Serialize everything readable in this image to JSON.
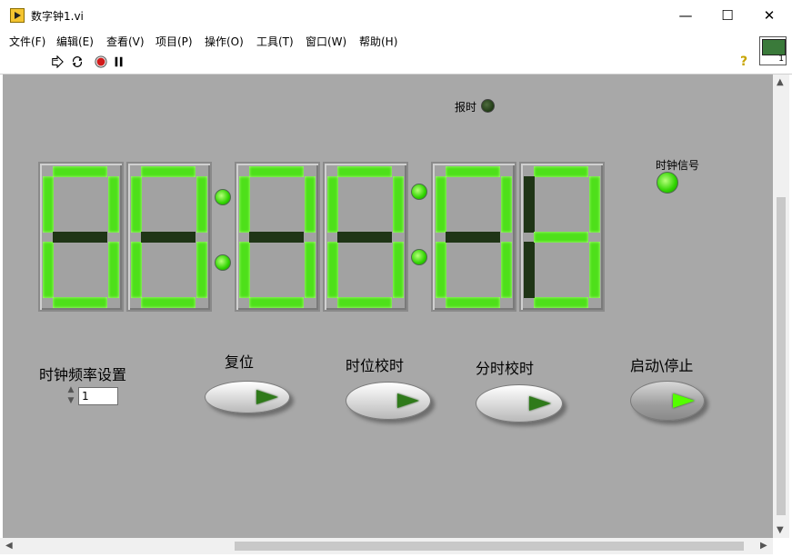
{
  "window": {
    "title": "数字钟1.vi",
    "minimize": "—",
    "maximize": "☐",
    "close": "✕"
  },
  "menu": [
    "文件(F)",
    "编辑(E)",
    "查看(V)",
    "项目(P)",
    "操作(O)",
    "工具(T)",
    "窗口(W)",
    "帮助(H)"
  ],
  "toolbar": {
    "icons": [
      "run-arrow-icon",
      "run-continuously-icon",
      "abort-icon",
      "pause-icon"
    ],
    "help": "?",
    "vi_icon_number": "1"
  },
  "panel": {
    "alarm_label": "报时",
    "alarm_state": "off",
    "clock_signal_label": "时钟信号",
    "clock_signal_state": "on",
    "freq_label": "时钟频率设置",
    "freq_value": "1",
    "reset_label": "复位",
    "hour_adjust_label": "时位校时",
    "minute_adjust_label": "分时校时",
    "start_stop_label": "启动\\停止",
    "digits": [
      {
        "on": "ABCDEF"
      },
      {
        "on": "ABCDEF"
      },
      {
        "on": "ABCDEF"
      },
      {
        "on": "ABCDEF"
      },
      {
        "on": "ABCDEF"
      },
      {
        "on": "ABCDG"
      }
    ],
    "colors": {
      "segment_on": "#4ee01a",
      "segment_off": "#1f3516",
      "panel_bg": "#a8a8a8"
    }
  }
}
